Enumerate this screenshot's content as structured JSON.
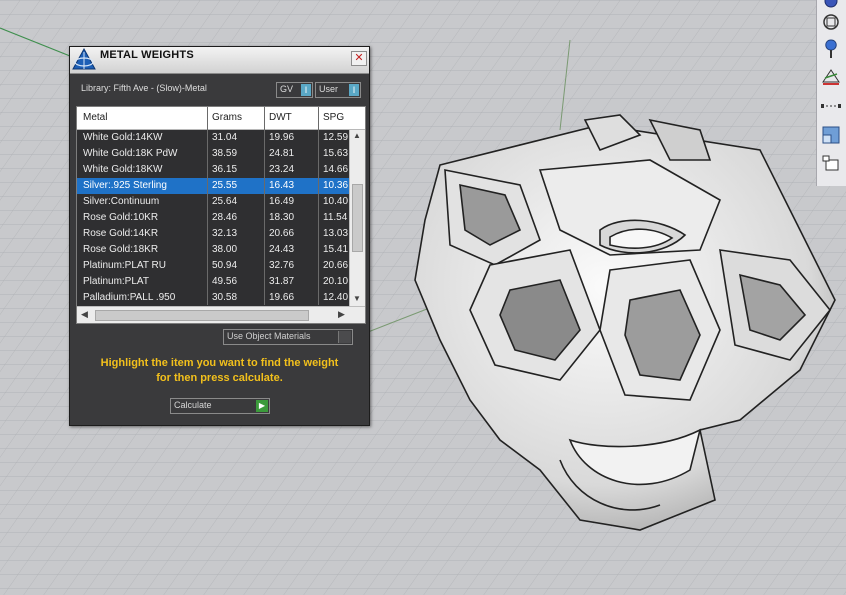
{
  "dialog": {
    "title": "METAL WEIGHTS",
    "close_glyph": "✕",
    "library_label": "Library: Fifth Ave - (Slow)-Metal",
    "toggle_gv": "GV",
    "toggle_user": "User",
    "toggle_glyph": "I",
    "table": {
      "headers": [
        "Metal",
        "Grams",
        "DWT",
        "SPG"
      ],
      "selected_row": 3,
      "rows": [
        [
          "White Gold:14KW",
          "31.04",
          "19.96",
          "12.59"
        ],
        [
          "White Gold:18K PdW",
          "38.59",
          "24.81",
          "15.63"
        ],
        [
          "White Gold:18KW",
          "36.15",
          "23.24",
          "14.66"
        ],
        [
          "Silver:.925 Sterling",
          "25.55",
          "16.43",
          "10.36"
        ],
        [
          "Silver:Continuum",
          "25.64",
          "16.49",
          "10.40"
        ],
        [
          "Rose Gold:10KR",
          "28.46",
          "18.30",
          "11.54"
        ],
        [
          "Rose Gold:14KR",
          "32.13",
          "20.66",
          "13.03"
        ],
        [
          "Rose Gold:18KR",
          "38.00",
          "24.43",
          "15.41"
        ],
        [
          "Platinum:PLAT RU",
          "50.94",
          "32.76",
          "20.66"
        ],
        [
          "Platinum:PLAT",
          "49.56",
          "31.87",
          "20.10"
        ],
        [
          "Palladium:PALL .950",
          "30.58",
          "19.66",
          "12.40"
        ]
      ]
    },
    "use_object_materials": "Use Object Materials",
    "instruction_line1": "Highlight the item you want to find the weight",
    "instruction_line2": "for then press calculate.",
    "calculate_label": "Calculate",
    "calculate_glyph": "▶"
  },
  "toolbar": {
    "icons": [
      "sphere-icon",
      "snap-icon",
      "light-icon",
      "layer-icon",
      "dimension-icon",
      "viewport-icon",
      "block-icon"
    ]
  },
  "colors": {
    "selection": "#1f72c7",
    "instruction": "#f2c01c",
    "dialog_bg": "#3a3a3c",
    "viewport_bg": "#c8c9cc"
  }
}
